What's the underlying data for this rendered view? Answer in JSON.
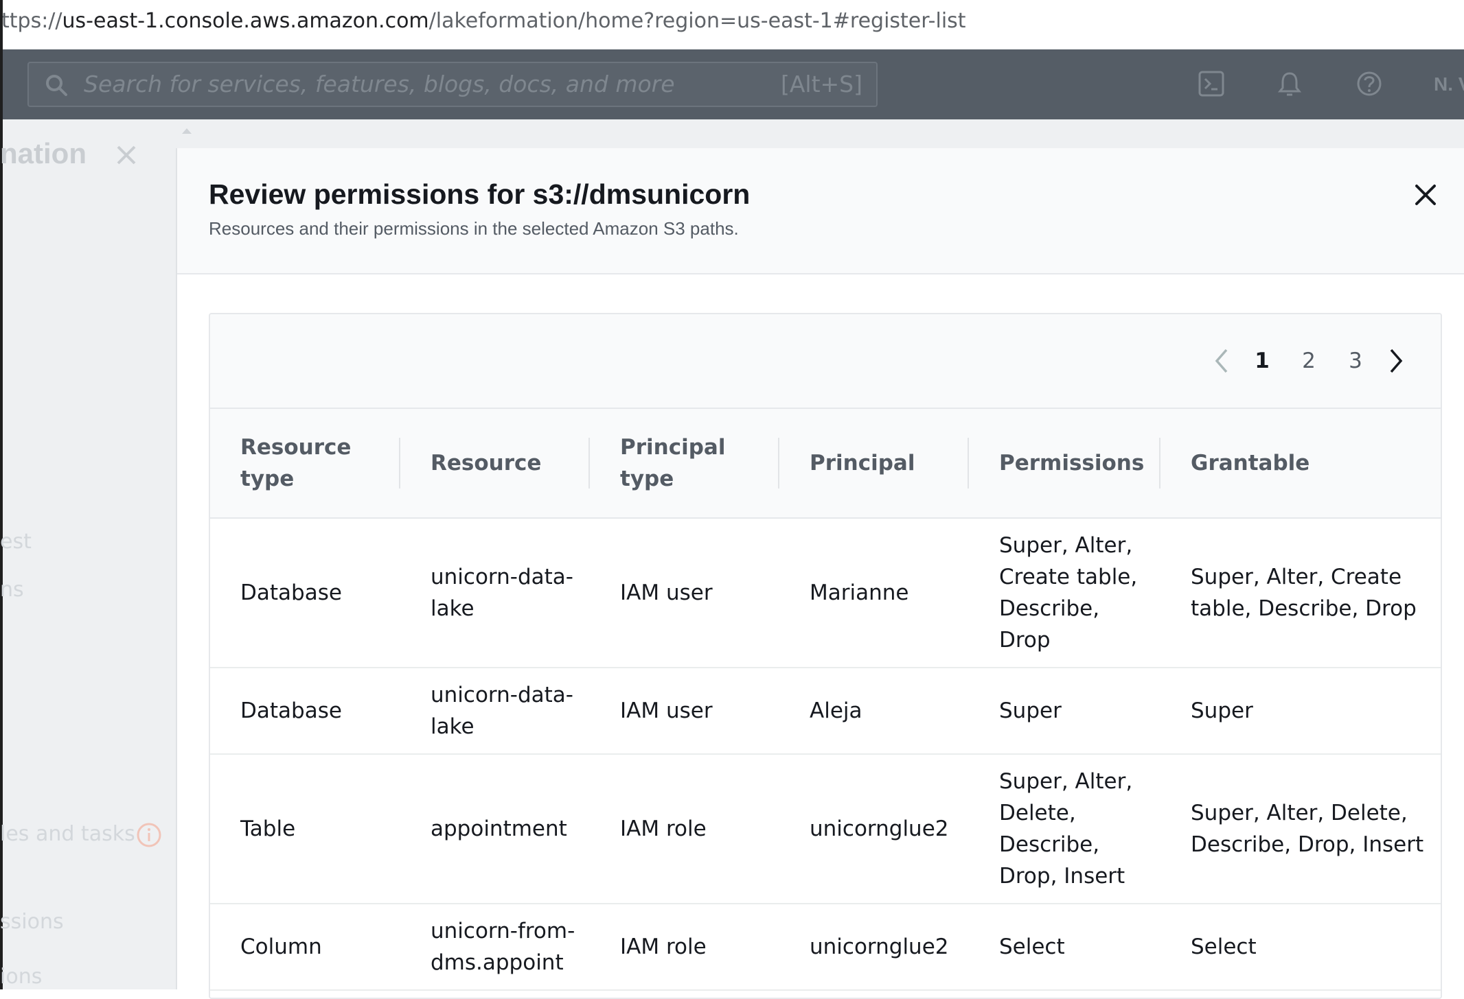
{
  "browser": {
    "url_prefix": "ttps://",
    "url_host": "us-east-1.console.aws.amazon.com",
    "url_path": "/lakeformation/home?region=us-east-1#register-list"
  },
  "aws_header": {
    "search_placeholder": "Search for services, features, blogs, docs, and more",
    "search_shortcut": "[Alt+S]",
    "region_label": "N. V"
  },
  "background_page": {
    "title_fragment": "nation",
    "nav_fragments": [
      "est",
      "ns",
      "les and tasks",
      "ssions",
      "ions"
    ]
  },
  "modal": {
    "title": "Review permissions for s3://dmsunicorn",
    "subtitle": "Resources and their permissions in the selected Amazon S3 paths.",
    "pagination": {
      "pages": [
        "1",
        "2",
        "3"
      ],
      "current": "1"
    },
    "table": {
      "columns": [
        "Resource type",
        "Resource",
        "Principal type",
        "Principal",
        "Permissions",
        "Grantable"
      ],
      "rows": [
        {
          "resource_type": "Database",
          "resource": "unicorn-data-lake",
          "principal_type": "IAM user",
          "principal": "Marianne",
          "permissions": "Super, Alter, Create table, Describe, Drop",
          "grantable": "Super, Alter, Create table, Describe, Drop"
        },
        {
          "resource_type": "Database",
          "resource": "unicorn-data-lake",
          "principal_type": "IAM user",
          "principal": "Aleja",
          "permissions": "Super",
          "grantable": "Super"
        },
        {
          "resource_type": "Table",
          "resource": "appointment",
          "principal_type": "IAM role",
          "principal": "unicornglue2",
          "permissions": "Super, Alter, Delete, Describe, Drop, Insert",
          "grantable": "Super, Alter, Delete, Describe, Drop, Insert"
        },
        {
          "resource_type": "Column",
          "resource": "unicorn-from-dms.appoint",
          "principal_type": "IAM role",
          "principal": "unicornglue2",
          "permissions": "Select",
          "grantable": "Select"
        }
      ]
    }
  },
  "colors": {
    "header_bg": "#555d66",
    "backdrop": "#eef0f2",
    "text_primary": "#16191f",
    "text_secondary": "#545b64"
  }
}
